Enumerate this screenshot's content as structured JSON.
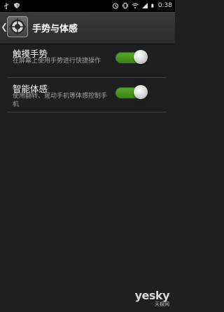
{
  "status_bar": {
    "time": "0:38",
    "left_icons": [
      "usb-icon",
      "shield-icon"
    ],
    "right_icons": [
      "alarm-icon",
      "vibrate-icon",
      "wifi-icon",
      "signal-icon",
      "battery-icon"
    ]
  },
  "action_bar": {
    "title": "手势与体感",
    "app_icon": "compass-settings-icon"
  },
  "settings": [
    {
      "title": "触摸手势",
      "description": "在屏幕上使用手势进行快捷操作",
      "enabled": true
    },
    {
      "title": "智能体感",
      "description": "使用翻转、晃动手机等体感控制手机",
      "enabled": true
    }
  ],
  "watermark": {
    "logo": "yesky",
    "sub": "天极网"
  },
  "colors": {
    "toggle_on": "#4a9a22",
    "background": "#1e1f20",
    "status_bar": "#000000"
  }
}
